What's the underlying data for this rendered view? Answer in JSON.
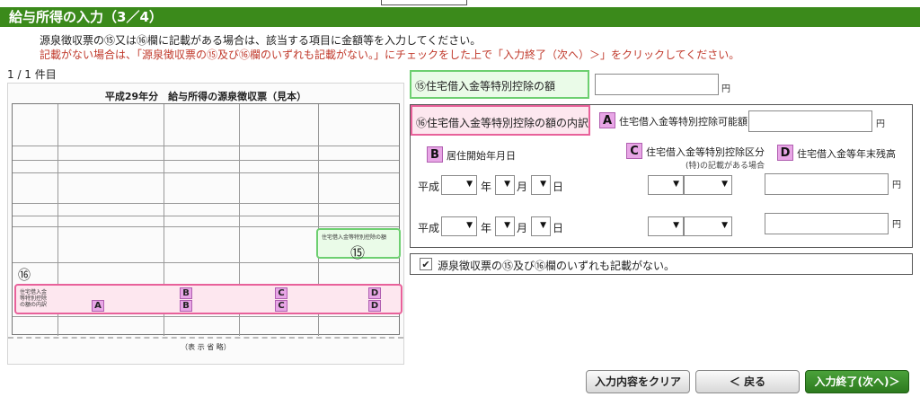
{
  "header": {
    "title": "給与所得の入力（3／4）"
  },
  "instructions": {
    "line1": "源泉徴収票の⑮又は⑯欄に記載がある場合は、該当する項目に金額等を入力してください。",
    "line2": "記載がない場合は、「源泉徴収票の⑮及び⑯欄のいずれも記載がない。」にチェックをした上で「入力終了（次へ）＞」をクリックしてください。"
  },
  "page_count": "1 / 1 件目",
  "sample": {
    "title": "平成29年分　給与所得の源泉徴収票（見本）",
    "box15_label": "住宅借入金等特別控除の額",
    "box15_num": "⑮",
    "box16_num": "⑯",
    "pink_label": "住宅借入金等特別控除の額の内訳",
    "badges": [
      "A",
      "B",
      "C",
      "D",
      "B",
      "C",
      "D"
    ],
    "omitted": "（表 示 省 略）"
  },
  "section15": {
    "label": "⑮住宅借入金等特別控除の額",
    "value": "",
    "unit": "円"
  },
  "section16": {
    "label": "⑯住宅借入金等特別控除の額の内訳",
    "a_badge": "A",
    "a_label": "住宅借入金等特別控除可能額",
    "a_value": "",
    "a_unit": "円",
    "b_badge": "B",
    "b_label": "居住開始年月日",
    "c_badge": "C",
    "c_label": "住宅借入金等特別控除区分",
    "c_sub": "(特)の記載がある場合",
    "d_badge": "D",
    "d_label": "住宅借入金等年末残高",
    "era": "平成",
    "year": "年",
    "month": "月",
    "day": "日",
    "yen": "円",
    "arrow": "▼"
  },
  "checkbox": {
    "checked": true,
    "mark": "✔",
    "label": "源泉徴収票の⑮及び⑯欄のいずれも記載がない。"
  },
  "buttons": {
    "clear": "入力内容をクリア",
    "back": "＜ 戻る",
    "next": "入力終了(次へ)＞"
  }
}
